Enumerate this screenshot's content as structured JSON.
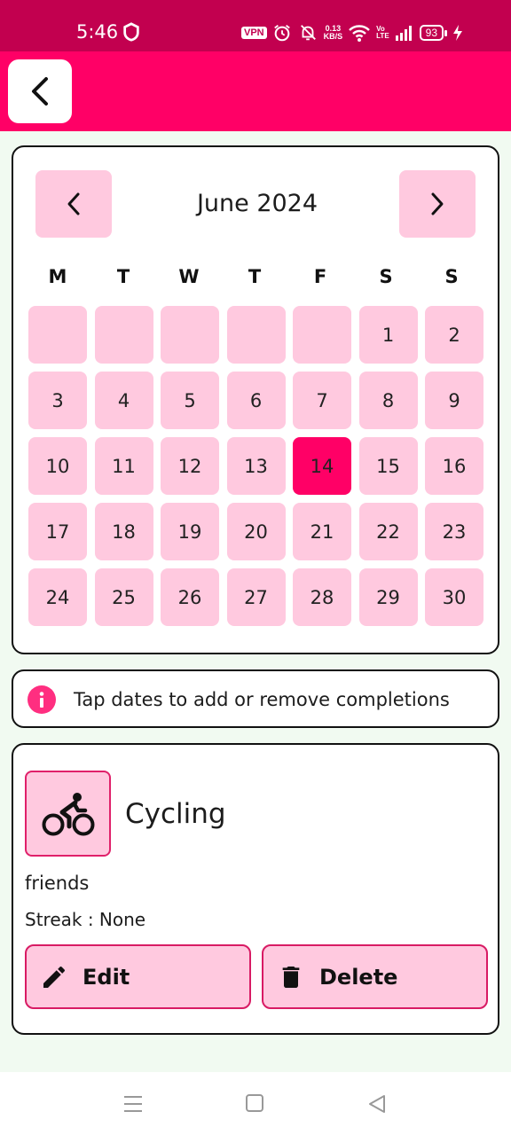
{
  "status_bar": {
    "time": "5:46",
    "vpn": "VPN",
    "speed_value": "0.13",
    "speed_unit": "KB/S",
    "volte_top": "Vo",
    "volte_bottom": "LTE",
    "battery": "93"
  },
  "calendar": {
    "month_title": "June 2024",
    "weekdays": [
      "M",
      "T",
      "W",
      "T",
      "F",
      "S",
      "S"
    ],
    "days": [
      "",
      "",
      "",
      "",
      "",
      "1",
      "2",
      "3",
      "4",
      "5",
      "6",
      "7",
      "8",
      "9",
      "10",
      "11",
      "12",
      "13",
      "14",
      "15",
      "16",
      "17",
      "18",
      "19",
      "20",
      "21",
      "22",
      "23",
      "24",
      "25",
      "26",
      "27",
      "28",
      "29",
      "30"
    ],
    "selected_day": "14"
  },
  "info": {
    "text": "Tap dates to add or remove completions"
  },
  "habit": {
    "icon": "bicycle-icon",
    "name": "Cycling",
    "description": "friends",
    "streak": "Streak : None",
    "edit_label": "Edit",
    "delete_label": "Delete"
  },
  "colors": {
    "status_bar": "#c2004f",
    "app_bar": "#ff0066",
    "accent_light": "#ffc9df",
    "selected": "#ff0066",
    "background": "#f1faf1"
  }
}
